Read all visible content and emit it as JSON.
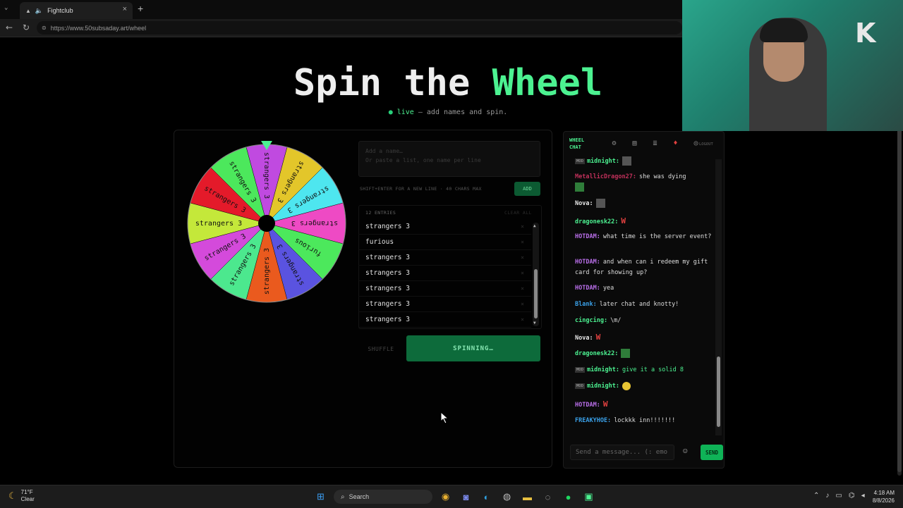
{
  "browser": {
    "tab_title": "Fightclub",
    "url": "https://www.50subsaday.art/wheel",
    "new_tab_symbol": "+",
    "close_symbol": "×"
  },
  "page": {
    "title_part1": "Spin the ",
    "title_accent": "Wheel",
    "subtitle_live": "live",
    "subtitle_rest": " — add names and spin.",
    "accent_color": "#4cf291"
  },
  "wheel": {
    "slices": [
      {
        "label": "strangers 3",
        "color": "#c04ae0"
      },
      {
        "label": "strangers 3",
        "color": "#e3c62a"
      },
      {
        "label": "strangers 3",
        "color": "#4ee6ef"
      },
      {
        "label": "strangers 3",
        "color": "#ee4ac4"
      },
      {
        "label": "furious",
        "color": "#4ce85c"
      },
      {
        "label": "strangers 3",
        "color": "#5a53e0"
      },
      {
        "label": "strangers 3",
        "color": "#ea5a1e"
      },
      {
        "label": "strangers 3",
        "color": "#4ce88e"
      },
      {
        "label": "strangers 3",
        "color": "#d44adb"
      },
      {
        "label": "strangers 3",
        "color": "#c4e83a"
      },
      {
        "label": "strangers 3",
        "color": "#e41a2a"
      },
      {
        "label": "strangers 3",
        "color": "#4ce85c"
      }
    ],
    "pointer_color": "#4cf291"
  },
  "form": {
    "input_placeholder": "Add a name…\nOr paste a list, one name per line",
    "hint": "SHIFT+ENTER FOR A NEW LINE · 40 CHARS MAX",
    "add_label": "ADD"
  },
  "entries": {
    "count_label": "12 ENTRIES",
    "clear_label": "CLEAR ALL",
    "items": [
      "strangers 3",
      "furious",
      "strangers 3",
      "strangers 3",
      "strangers 3",
      "strangers 3",
      "strangers 3"
    ],
    "remove_symbol": "×"
  },
  "controls": {
    "shuffle_label": "SHUFFLE",
    "spin_label": "SPINNING…"
  },
  "chat": {
    "title": "WHEEL\nCHAT",
    "logout_label": "LOGOUT",
    "input_placeholder": "Send a message... (: emo",
    "send_label": "SEND",
    "messages": [
      {
        "mod": true,
        "user": "midnight:",
        "color": "#4cf291",
        "text": "",
        "emote": "grey"
      },
      {
        "mod": false,
        "user": "MetallicDragon27:",
        "color": "#c0305a",
        "text": "she was dying",
        "emote": "img"
      },
      {
        "mod": false,
        "user": "Nova:",
        "color": "#e6e6e6",
        "text": "",
        "emote": "grey"
      },
      {
        "mod": false,
        "user": "dragonesk22:",
        "color": "#4cf291",
        "text": "",
        "emote": "w"
      },
      {
        "mod": false,
        "user": "HOTDAM:",
        "color": "#b86ee8",
        "text": "what time is the server event?",
        "emote": ""
      },
      {
        "mod": false,
        "user": "HOTDAM:",
        "color": "#b86ee8",
        "text": "and when can i redeem my gift card for showing up?",
        "emote": ""
      },
      {
        "mod": false,
        "user": "HOTDAM:",
        "color": "#b86ee8",
        "text": "yea",
        "emote": ""
      },
      {
        "mod": false,
        "user": "Blank:",
        "color": "#3aa0e8",
        "text": "later chat and knotty!",
        "emote": ""
      },
      {
        "mod": false,
        "user": "cingcing:",
        "color": "#4cf291",
        "text": "\\m/",
        "emote": ""
      },
      {
        "mod": false,
        "user": "Nova:",
        "color": "#e6e6e6",
        "text": "",
        "emote": "w"
      },
      {
        "mod": false,
        "user": "dragonesk22:",
        "color": "#4cf291",
        "text": "",
        "emote": "img"
      },
      {
        "mod": true,
        "user": "midnight:",
        "color": "#4cf291",
        "text": "give it a solid 8",
        "emote": "",
        "text_color": "#4cf291"
      },
      {
        "mod": true,
        "user": "midnight:",
        "color": "#4cf291",
        "text": "",
        "emote": "face"
      },
      {
        "mod": false,
        "user": "HOTDAM:",
        "color": "#b86ee8",
        "text": "",
        "emote": "w"
      },
      {
        "mod": false,
        "user": "FREAKYHOE:",
        "color": "#3aa0e8",
        "text": "lockkk inn!!!!!!!",
        "emote": ""
      }
    ],
    "mod_badge": "MOD",
    "w_emote": "W"
  },
  "webcam": {
    "logo": "K"
  },
  "taskbar": {
    "weather_temp": "71°F",
    "weather_desc": "Clear",
    "search_label": "Search",
    "time": "4:18 AM",
    "date": "8/8/2026"
  }
}
